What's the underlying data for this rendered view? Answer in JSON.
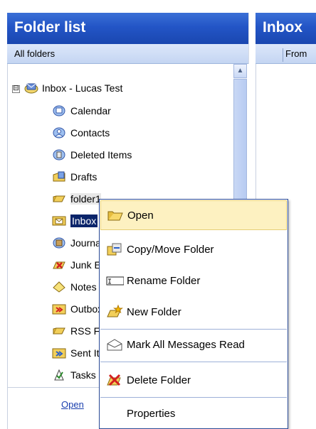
{
  "left_pane": {
    "title": "Folder list",
    "subheader": "All folders",
    "tree": {
      "root": {
        "label": "Inbox - Lucas Test",
        "expander": "⊟"
      },
      "items": [
        {
          "label": "Calendar",
          "icon": "calendar-icon"
        },
        {
          "label": "Contacts",
          "icon": "contacts-icon"
        },
        {
          "label": "Deleted Items",
          "icon": "deleted-items-icon"
        },
        {
          "label": "Drafts",
          "icon": "drafts-icon"
        },
        {
          "label": "folder1",
          "icon": "folder-icon"
        },
        {
          "label": "Inbox",
          "icon": "inbox-icon"
        },
        {
          "label": "Journal",
          "icon": "journal-icon"
        },
        {
          "label": "Junk E-mail",
          "icon": "junk-icon"
        },
        {
          "label": "Notes",
          "icon": "notes-icon"
        },
        {
          "label": "Outbox",
          "icon": "outbox-icon"
        },
        {
          "label": "RSS Feeds",
          "icon": "rss-folder-icon"
        },
        {
          "label": "Sent Items",
          "icon": "sent-items-icon"
        },
        {
          "label": "Tasks",
          "icon": "tasks-icon"
        }
      ]
    },
    "footer_link": "Open"
  },
  "right_pane": {
    "title": "Inbox",
    "column_header": "From"
  },
  "context_menu": {
    "items": [
      {
        "label": "Open",
        "icon": "open-folder-icon"
      },
      {
        "label": "Copy/Move Folder",
        "icon": "copy-move-icon"
      },
      {
        "label": "Rename Folder",
        "icon": "rename-icon"
      },
      {
        "label": "New Folder",
        "icon": "new-folder-icon"
      },
      {
        "label": "Mark All Messages Read",
        "icon": "mark-read-icon"
      },
      {
        "label": "Delete Folder",
        "icon": "delete-folder-icon"
      },
      {
        "label": "Properties",
        "icon": ""
      }
    ]
  },
  "colors": {
    "header_blue": "#2355c6",
    "selection": "#0a246a",
    "menu_highlight": "#fdf1c1"
  }
}
